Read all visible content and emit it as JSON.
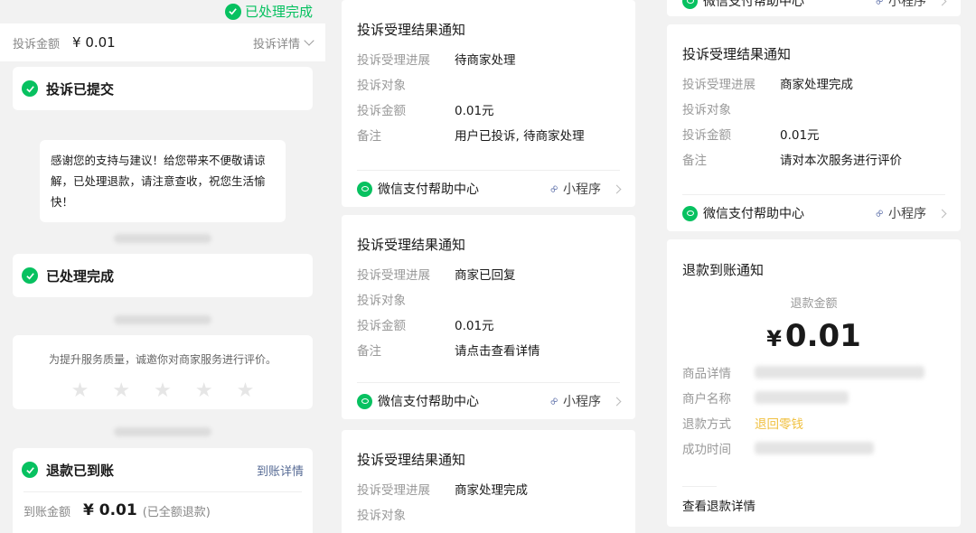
{
  "col1": {
    "top_status": "已处理完成",
    "header": {
      "label": "投诉金额",
      "amount": "¥ 0.01",
      "detail": "投诉详情"
    },
    "step_submitted": "投诉已提交",
    "merchant_message": "感谢您的支持与建议！给您带来不便敬请谅解，已处理退款，请注意查收，祝您生活愉快！",
    "step_done": "已处理完成",
    "rating_prompt": "为提升服务质量，诚邀你对商家服务进行评价。",
    "stars": [
      "★",
      "★",
      "★",
      "★",
      "★"
    ],
    "refund": {
      "title": "退款已到账",
      "detail_link": "到账详情",
      "amount_label": "到账金额",
      "amount": "¥ 0.01",
      "note": "(已全额退款)"
    }
  },
  "notice": {
    "title": "投诉受理结果通知",
    "k_progress": "投诉受理进展",
    "k_target": "投诉对象",
    "k_amount": "投诉金额",
    "k_remark": "备注",
    "footer_source": "微信支付帮助中心",
    "footer_mini": "小程序"
  },
  "col2": {
    "card1": {
      "progress": "待商家处理",
      "amount": "0.01元",
      "remark": "用户已投诉, 待商家处理"
    },
    "card2": {
      "progress": "商家已回复",
      "amount": "0.01元",
      "remark": "请点击查看详情"
    },
    "card3": {
      "progress": "商家处理完成"
    }
  },
  "col3": {
    "top_source": "微信支付帮助中心",
    "top_mini": "小程序",
    "card1": {
      "progress": "商家处理完成",
      "amount": "0.01元",
      "remark": "请对本次服务进行评价"
    },
    "refund_notice": {
      "title": "退款到账通知",
      "amount_label": "退款金额",
      "currency": "¥",
      "amount": "0.01",
      "k_goods": "商品详情",
      "k_merchant": "商户名称",
      "k_method": "退款方式",
      "method": "退回零钱",
      "k_time": "成功时间",
      "view_detail": "查看退款详情"
    }
  },
  "colors": {
    "accent_green": "#07c160",
    "link_blue": "#576b95",
    "method_yellow": "#f0c040"
  }
}
